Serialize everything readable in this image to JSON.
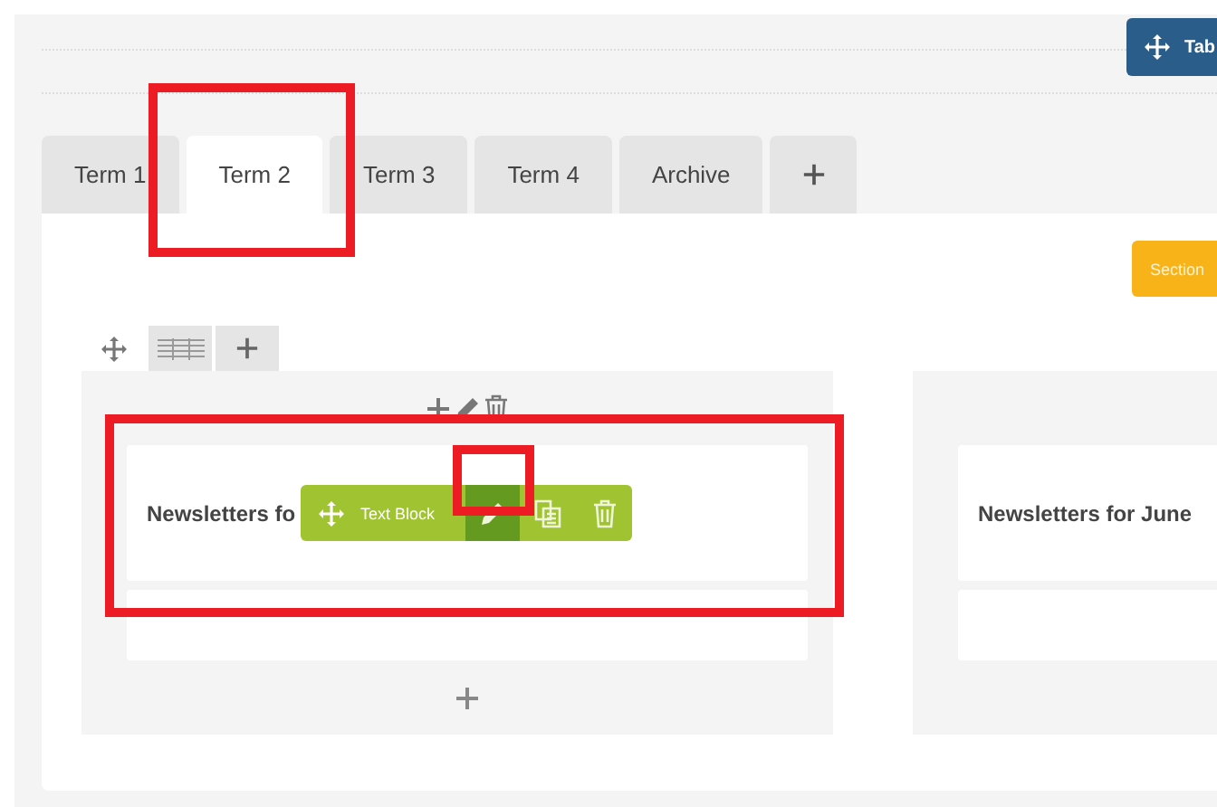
{
  "top_button": {
    "label": "Tab"
  },
  "tabs": [
    {
      "label": "Term 1",
      "selected": false
    },
    {
      "label": "Term 2",
      "selected": true
    },
    {
      "label": "Term 3",
      "selected": false
    },
    {
      "label": "Term 4",
      "selected": false
    },
    {
      "label": "Archive",
      "selected": false
    }
  ],
  "section_button": {
    "label": "Section"
  },
  "columns": [
    {
      "block_title": "Newsletters fo",
      "toolbar": {
        "label": "Text Block",
        "actions": [
          {
            "kind": "edit",
            "selected": true
          },
          {
            "kind": "copy",
            "selected": false
          },
          {
            "kind": "delete",
            "selected": false
          }
        ]
      }
    },
    {
      "block_title": "Newsletters for June"
    }
  ]
}
